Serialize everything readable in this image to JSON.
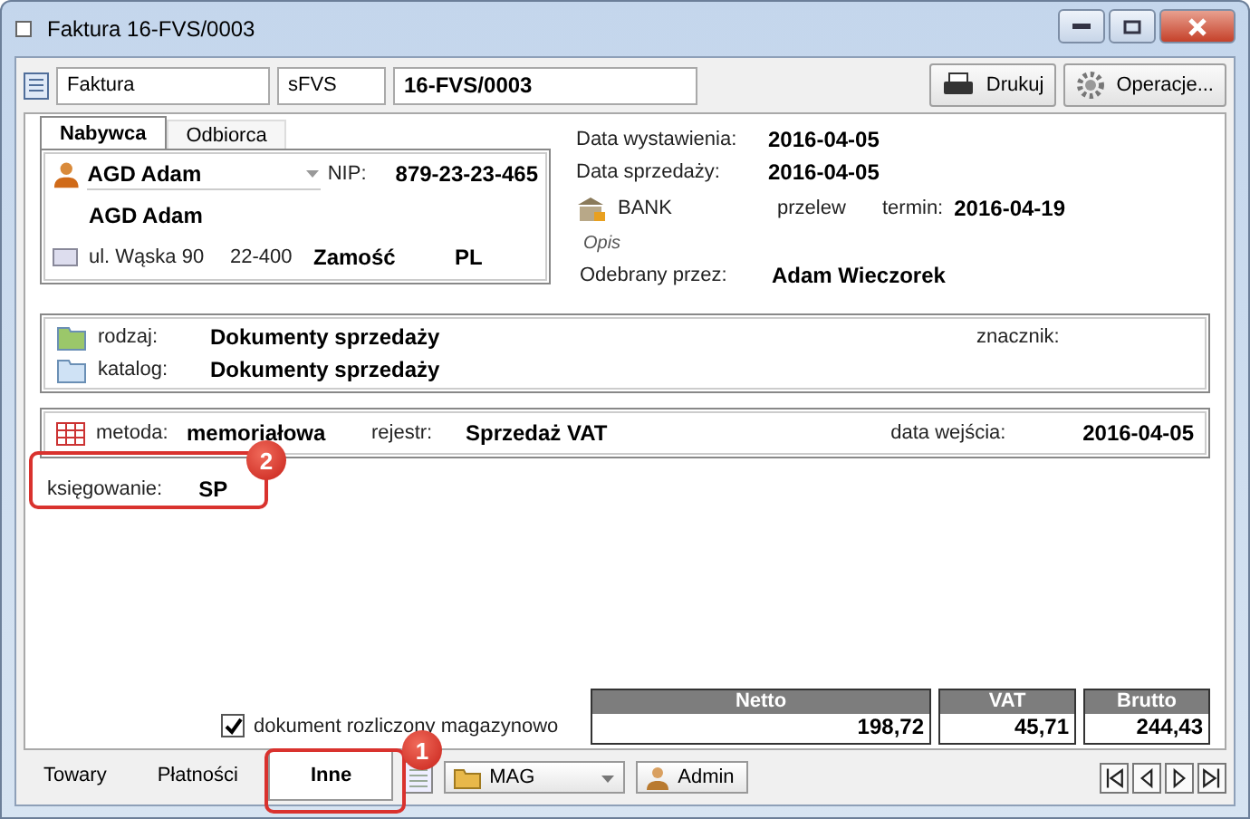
{
  "window": {
    "title": "Faktura 16-FVS/0003"
  },
  "header": {
    "document_type": "Faktura",
    "series": "sFVS",
    "number": "16-FVS/0003",
    "print_button": "Drukuj",
    "operations_button": "Operacje..."
  },
  "party_tabs": [
    {
      "label": "Nabywca",
      "selected": true
    },
    {
      "label": "Odbiorca",
      "selected": false
    }
  ],
  "buyer": {
    "name": "AGD Adam",
    "nip_label": "NIP:",
    "nip": "879-23-23-465",
    "full_name": "AGD Adam",
    "street": "ul. Wąska 90",
    "postal_code": "22-400",
    "city": "Zamość",
    "country": "PL"
  },
  "details": {
    "issue_date_label": "Data wystawienia:",
    "issue_date": "2016-04-05",
    "sale_date_label": "Data sprzedaży:",
    "sale_date": "2016-04-05",
    "payment_method": "BANK",
    "payment_form": "przelew",
    "due_label": "termin:",
    "due_date": "2016-04-19",
    "description_placeholder": "Opis",
    "received_by_label": "Odebrany przez:",
    "received_by": "Adam Wieczorek"
  },
  "category": {
    "kind_label": "rodzaj:",
    "kind": "Dokumenty sprzedaży",
    "catalog_label": "katalog:",
    "catalog": "Dokumenty sprzedaży",
    "tag_label": "znacznik:"
  },
  "accounting": {
    "method_label": "metoda:",
    "method": "memoriałowa",
    "register_label": "rejestr:",
    "register": "Sprzedaż VAT",
    "entry_date_label": "data wejścia:",
    "entry_date": "2016-04-05",
    "posting_label": "księgowanie:",
    "posting": "SP"
  },
  "warehouse_checkbox": {
    "label": "dokument rozliczony magazynowo",
    "checked": true
  },
  "totals": [
    {
      "label": "Netto",
      "value": "198,72"
    },
    {
      "label": "VAT",
      "value": "45,71"
    },
    {
      "label": "Brutto",
      "value": "244,43"
    }
  ],
  "bottom_tabs": [
    {
      "label": "Towary",
      "selected": false
    },
    {
      "label": "Płatności",
      "selected": false
    },
    {
      "label": "Inne",
      "selected": true
    }
  ],
  "warehouse": "MAG",
  "user": "Admin",
  "callouts": [
    {
      "label": "1"
    },
    {
      "label": "2"
    }
  ]
}
